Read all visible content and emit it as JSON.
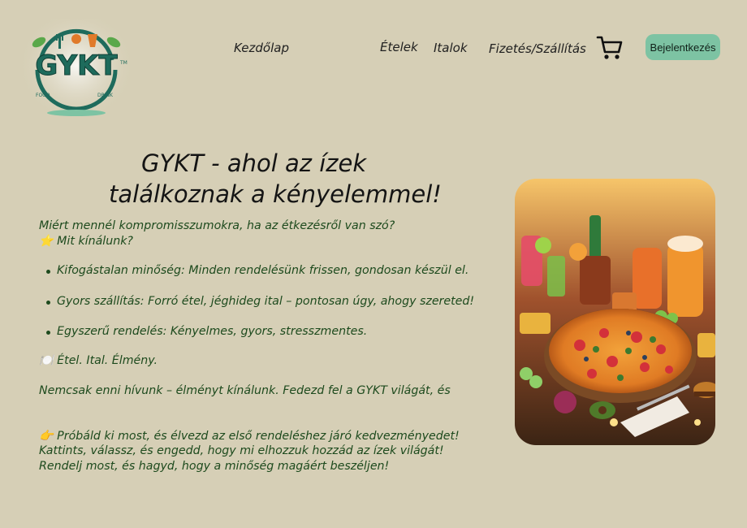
{
  "logo": {
    "text": "GYKT",
    "left_caption": "FOOD",
    "right_caption": "DRINK",
    "tm": "TM"
  },
  "nav": {
    "home": "Kezdőlap",
    "food": "Ételek",
    "drinks": "Italok",
    "payment": "Fizetés/Szállítás"
  },
  "header": {
    "login_label": "Bejelentkezés",
    "cart_icon": "shopping-cart-icon"
  },
  "hero": {
    "title_line1": "GYKT - ahol az ízek",
    "title_line2": "találkoznak a kényelemmel!"
  },
  "intro": {
    "question": "Miért mennél kompromisszumokra, ha az étkezésről van szó?",
    "offer": "⭐ Mit kínálunk?"
  },
  "features": [
    "Kifogástalan minőség: Minden rendelésünk frissen, gondosan készül el.",
    "Gyors szállítás: Forró étel, jéghideg ital – pontosan úgy, ahogy szereted!",
    "Egyszerű rendelés: Kényelmes, gyors, stresszmentes."
  ],
  "tagline": "🍽️ Étel. Ital. Élmény.",
  "description": "Nemcsak enni hívunk – élményt kínálunk. Fedezd fel a GYKT világát, és",
  "cta": {
    "line1": "👉 Próbáld ki most, és élvezd az első rendeléshez járó kedvezményedet!",
    "line2": "Kattints, válassz, és engedd, hogy mi elhozzuk hozzád az ízek világát!",
    "line3": "Rendelj most, és hagyd, hogy a minőség magáért beszéljen!"
  },
  "colors": {
    "background": "#d6cfb6",
    "accent": "#7dc3a3",
    "text_green": "#1d4a1d",
    "logo_green": "#1e6b5c"
  }
}
